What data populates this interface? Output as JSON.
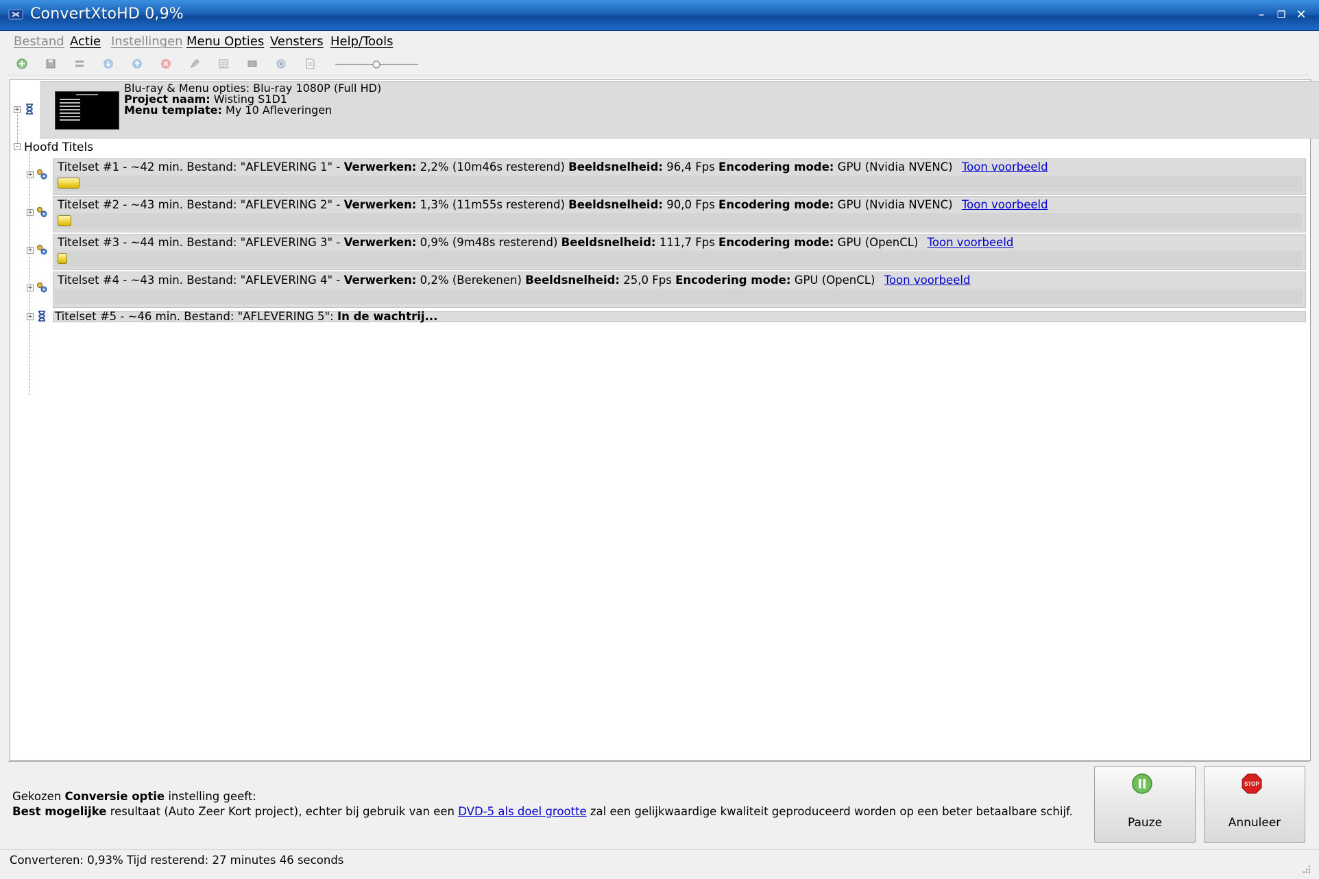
{
  "window": {
    "title": "ConvertXtoHD 0,9%",
    "minimize_glyph": "–",
    "maximize_glyph": "❐",
    "close_glyph": "✕"
  },
  "menu": [
    {
      "label": "Bestand",
      "enabled": false
    },
    {
      "label": "Actie",
      "enabled": true
    },
    {
      "label": "Instellingen",
      "enabled": false
    },
    {
      "label": "Menu Opties",
      "enabled": true
    },
    {
      "label": "Vensters",
      "enabled": true
    },
    {
      "label": "Help/Tools",
      "enabled": true
    }
  ],
  "toolbar": {
    "icons": [
      "add-icon",
      "save-icon",
      "convert-icon",
      "move-down-icon",
      "move-up-icon",
      "delete-icon",
      "edit-icon",
      "properties-icon",
      "video-icon",
      "audio-icon",
      "subtitle-icon"
    ],
    "zoom_slider_level": 0.5
  },
  "disc": {
    "line1": "Blu-ray & Menu opties: Blu-ray 1080P (Full HD)",
    "project_label": "Project naam:",
    "project_value": "Wisting S1D1",
    "template_label": "Menu template:",
    "template_value": "My  10 Afleveringen"
  },
  "section_label": "Hoofd Titels",
  "titlesets": [
    {
      "prefix": "Titelset #1 - ~42 min. Bestand: \"AFLEVERING 1\" - ",
      "proc_label": "Verwerken:",
      "proc_value": " 2,2% (10m46s resterend) ",
      "fps_label": "Beeldsnelheid:",
      "fps_value": " 96,4 Fps ",
      "mode_label": "Encodering mode:",
      "mode_value": " GPU (Nvidia NVENC)",
      "link": "Toon voorbeeld",
      "progress": 0.022
    },
    {
      "prefix": "Titelset #2 - ~43 min. Bestand: \"AFLEVERING 2\" - ",
      "proc_label": "Verwerken:",
      "proc_value": " 1,3% (11m55s resterend) ",
      "fps_label": "Beeldsnelheid:",
      "fps_value": " 90,0 Fps ",
      "mode_label": "Encodering mode:",
      "mode_value": " GPU (Nvidia NVENC)",
      "link": "Toon voorbeeld",
      "progress": 0.013
    },
    {
      "prefix": "Titelset #3 - ~44 min. Bestand: \"AFLEVERING 3\" - ",
      "proc_label": "Verwerken:",
      "proc_value": " 0,9% (9m48s resterend) ",
      "fps_label": "Beeldsnelheid:",
      "fps_value": " 111,7 Fps ",
      "mode_label": "Encodering mode:",
      "mode_value": " GPU (OpenCL)",
      "link": "Toon voorbeeld",
      "progress": 0.009
    },
    {
      "prefix": "Titelset #4 - ~43 min. Bestand: \"AFLEVERING 4\" - ",
      "proc_label": "Verwerken:",
      "proc_value": " 0,2% (Berekenen) ",
      "fps_label": "Beeldsnelheid:",
      "fps_value": " 25,0 Fps ",
      "mode_label": "Encodering mode:",
      "mode_value": " GPU (OpenCL)",
      "link": "Toon voorbeeld",
      "progress": 0.002
    }
  ],
  "queued": {
    "prefix": "Titelset #5 - ~46 min. Bestand: \"AFLEVERING 5\": ",
    "status": "In de wachtrij..."
  },
  "info": {
    "line1_a": "Gekozen ",
    "line1_b": "Conversie optie",
    "line1_c": " instelling geeft:",
    "line2_a": "Best mogelijke",
    "line2_b": " resultaat (Auto Zeer Kort project), echter bij gebruik van een ",
    "line2_link": "DVD-5 als doel grootte",
    "line2_c": " zal een gelijkwaardige kwaliteit geproduceerd worden op een beter betaalbare schijf."
  },
  "buttons": {
    "pause": "Pauze",
    "cancel": "Annuleer",
    "stop_sign_text": "STOP"
  },
  "status": "Converteren: 0,93% Tijd resterend: 27 minutes 46 seconds",
  "colors": {
    "titlebar": "#1a62b8",
    "progress": "#f3d84a",
    "link": "#0000cc"
  }
}
